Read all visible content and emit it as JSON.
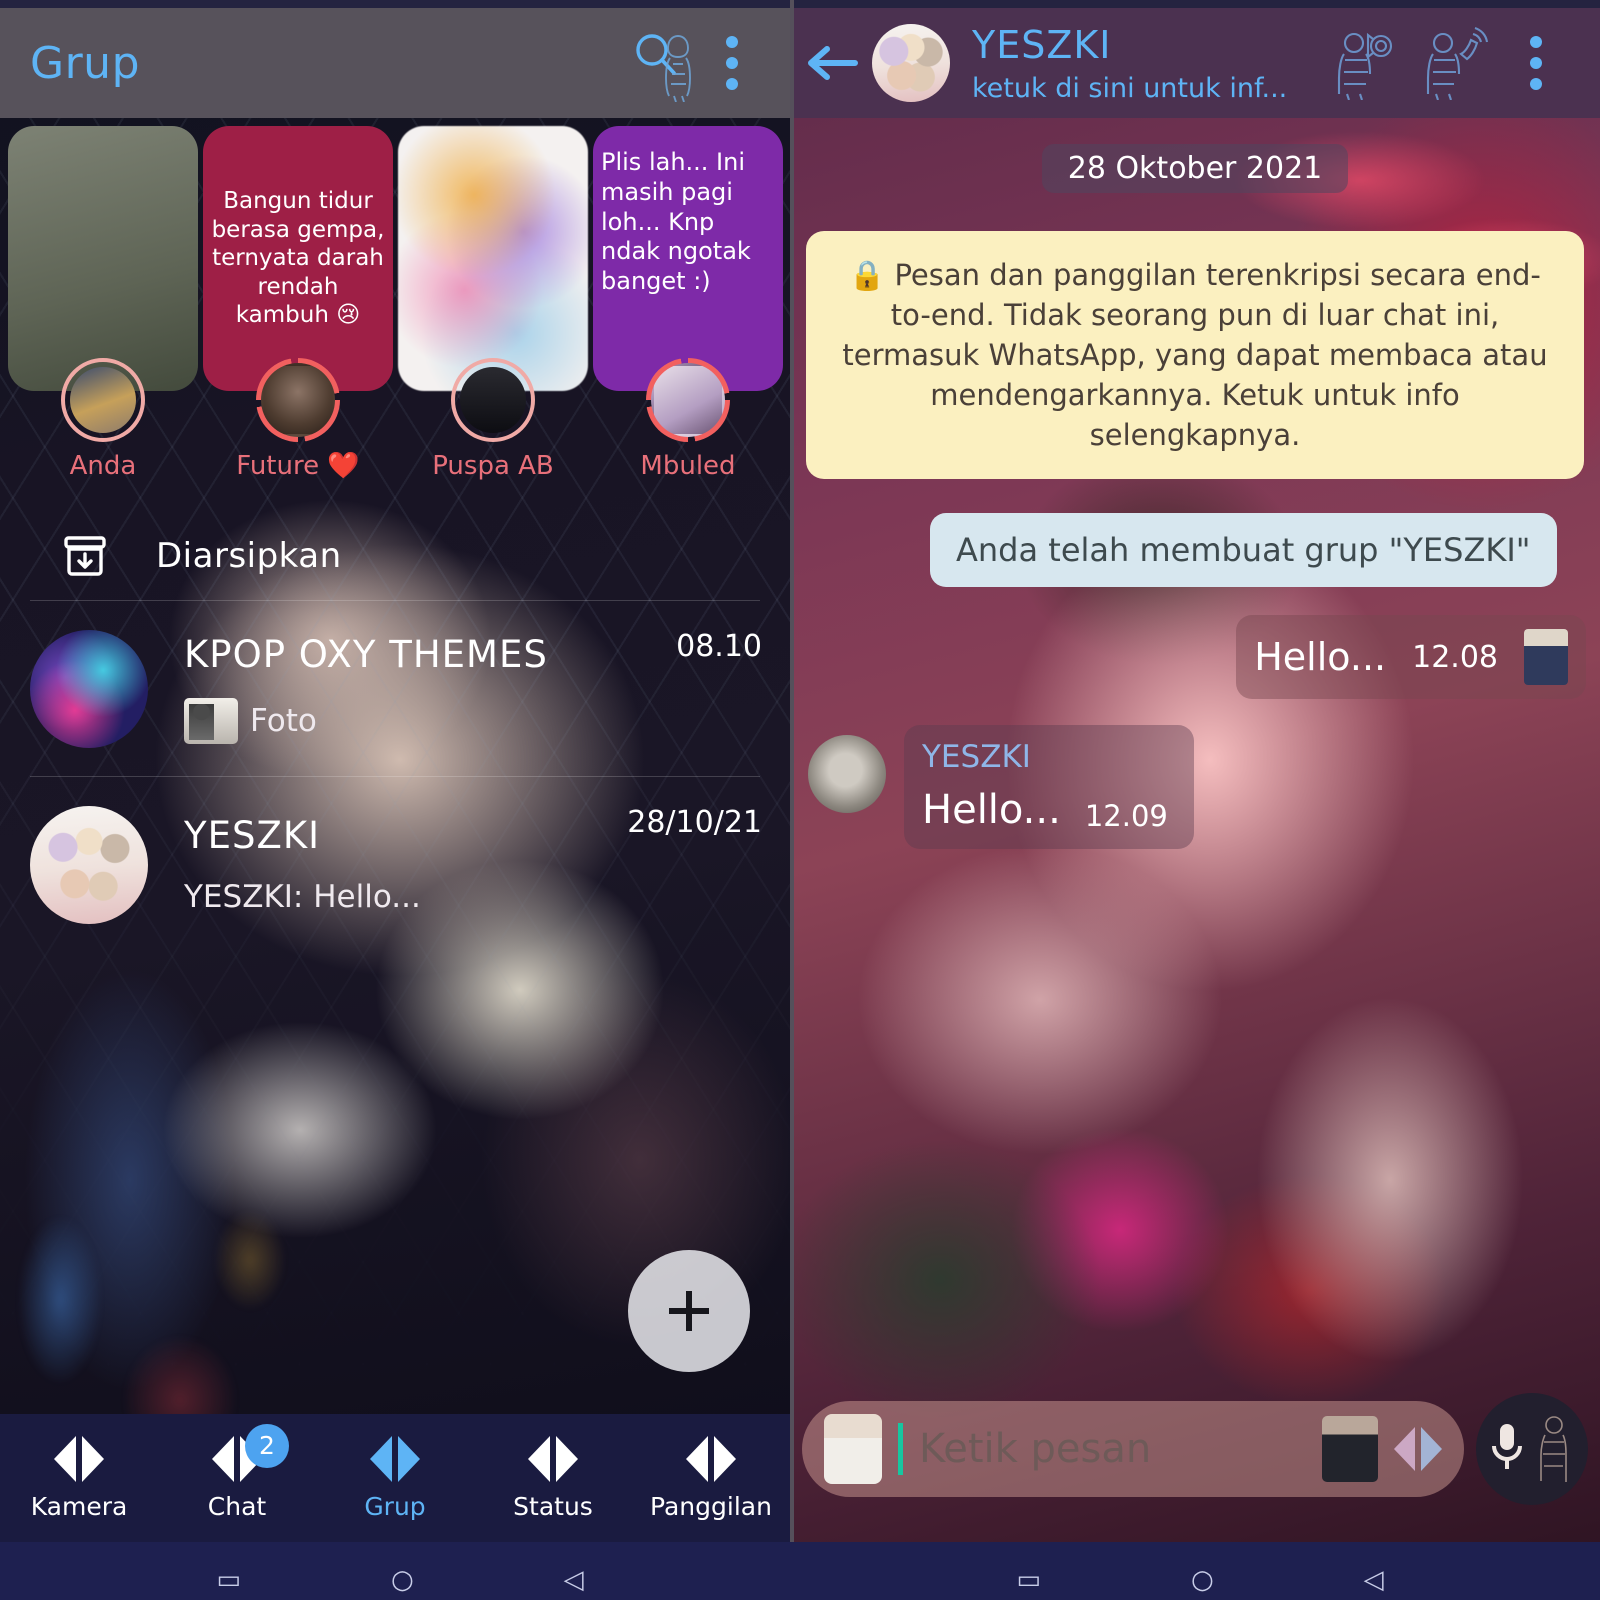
{
  "left_panel": {
    "appbar": {
      "title": "Grup",
      "search_icon": "search-person-icon",
      "menu_icon": "overflow-menu-icon"
    },
    "status_tray": [
      {
        "caption": "",
        "name": "Anda",
        "card_bg": "#7b7f72",
        "ring": "solid",
        "avatar": "masked-person"
      },
      {
        "caption": "Bangun tidur berasa gempa, ternyata darah rendah kambuh 😢",
        "name": "Future ❤️",
        "card_bg": "#9e1f46",
        "ring": "dash",
        "avatar": "baby-monkey"
      },
      {
        "caption": "",
        "name": "Puspa AB",
        "card_bg": "#f2f0ef",
        "ring": "solid",
        "avatar": "hand-person"
      },
      {
        "caption": "Plis lah... Ini masih pagi loh... Knp ndak ngotak banget :)",
        "name": "Mbuled",
        "card_bg": "#7e2aa8",
        "ring": "dash",
        "avatar": "couple-photo"
      }
    ],
    "archived": {
      "label": "Diarsipkan",
      "icon": "archive-box-icon"
    },
    "chats": [
      {
        "name": "KPOP OXY THEMES",
        "preview": "Foto",
        "time": "08.10",
        "has_thumb": true,
        "avatar": "kpop-themes-logo"
      },
      {
        "name": "YESZKI",
        "preview": "YESZKI:  Hello...",
        "time": "28/10/21",
        "has_thumb": false,
        "avatar": "bts-group-photo"
      }
    ],
    "fab": {
      "icon": "plus-icon"
    },
    "bottom_nav": [
      {
        "label": "Kamera",
        "active": false,
        "badge": ""
      },
      {
        "label": "Chat",
        "active": false,
        "badge": "2"
      },
      {
        "label": "Grup",
        "active": true,
        "badge": ""
      },
      {
        "label": "Status",
        "active": false,
        "badge": ""
      },
      {
        "label": "Panggilan",
        "active": false,
        "badge": ""
      }
    ]
  },
  "right_panel": {
    "appbar": {
      "back_icon": "back-arrow-icon",
      "title": "YESZKI",
      "subtitle": "ketuk di sini untuk inf...",
      "video_call_icon": "video-call-person-icon",
      "voice_call_icon": "voice-call-person-icon",
      "menu_icon": "overflow-menu-icon",
      "avatar": "bts-group-photo"
    },
    "date_divider": "28 Oktober 2021",
    "encryption_notice": "🔒 Pesan dan panggilan terenkripsi secara end-to-end. Tidak seorang pun di luar chat ini, termasuk WhatsApp, yang dapat membaca atau mendengarkannya. Ketuk untuk info selengkapnya.",
    "system_message": "Anda telah membuat grup \"YESZKI\"",
    "messages": [
      {
        "direction": "out",
        "text": "Hello...",
        "time": "12.08",
        "sender": "",
        "receipt": "read-receipt-image"
      },
      {
        "direction": "in",
        "text": "Hello...",
        "time": "12.09",
        "sender": "YESZKI",
        "receipt": ""
      }
    ],
    "composer": {
      "placeholder": "Ketik pesan",
      "emoji_icon": "emoji-person-icon",
      "attach_icon": "attach-person-icon",
      "camera_icon": "camera-bts-icon",
      "mic_icon": "mic-person-icon"
    }
  },
  "system_nav": {
    "recents": "▭",
    "home": "○",
    "back": "◁"
  },
  "colors": {
    "accent_blue": "#5eb4f5",
    "left_appbar": "#57525b",
    "right_appbar": "#4b3150",
    "bottom_nav": "#1a1b40",
    "encryption_bg": "#fbf0c0",
    "system_msg_bg": "#d7e7ef",
    "status_name": "#e8707a"
  }
}
